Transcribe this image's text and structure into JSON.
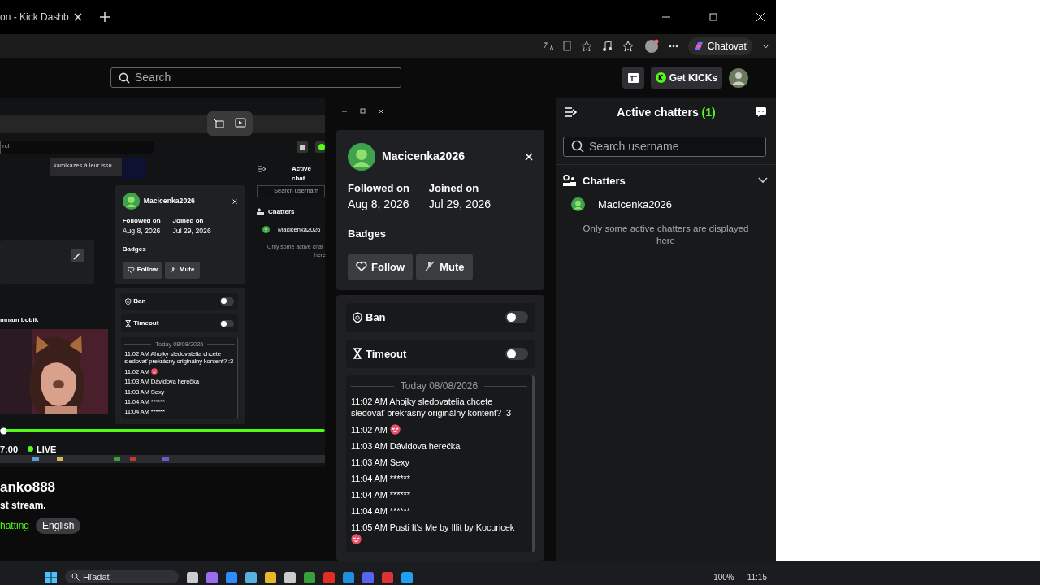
{
  "browser": {
    "tab_title": "on - Kick Dashb",
    "copilot_label": "Chatovať"
  },
  "header": {
    "search_placeholder": "Search",
    "kicks_button": "Get KICKs"
  },
  "preview": {
    "search_value": "rch",
    "tile_text": "kamikazes à leur issu",
    "caption": "mnam bobik",
    "time": "7:00",
    "live": "LIVE",
    "user_card": {
      "username": "Macicenka2026",
      "stats": [
        {
          "label": "Followed on",
          "value": "Aug 8, 2026"
        },
        {
          "label": "Joined on",
          "value": "Jul 29, 2026"
        }
      ],
      "badges_label": "Badges",
      "buttons": [
        {
          "kind": "follow",
          "label": "Follow"
        },
        {
          "kind": "mute",
          "label": "Mute"
        }
      ],
      "actions": [
        {
          "kind": "ban",
          "label": "Ban",
          "on": false
        },
        {
          "kind": "timeout",
          "label": "Timeout",
          "on": false
        }
      ],
      "chat_date": "Today 08/08/2026",
      "messages": [
        {
          "time": "11:02 AM",
          "text": "Ahojky sledovatelia chcete sledovať prekrásny originálny kontent? :3"
        },
        {
          "time": "11:02 AM",
          "emote": true
        },
        {
          "time": "11:03 AM",
          "text": "Dávidova herečka"
        },
        {
          "time": "11:03 AM",
          "text": "Sexy"
        },
        {
          "time": "11:04 AM",
          "text": "******"
        },
        {
          "time": "11:04 AM",
          "text": "******"
        }
      ]
    },
    "chatters": {
      "title": "Active chat",
      "search_placeholder": "Search usernam",
      "section": "Chatters",
      "user": "Macicenka2026",
      "note_lines": [
        "Only some active chat",
        "here"
      ]
    }
  },
  "stream": {
    "channel": "anko888",
    "description": "st stream.",
    "category": "hatting",
    "tags": [
      "English"
    ]
  },
  "user_card": {
    "username": "Macicenka2026",
    "stats": [
      {
        "label": "Followed on",
        "value": "Aug 8, 2026"
      },
      {
        "label": "Joined on",
        "value": "Jul 29, 2026"
      }
    ],
    "badges_label": "Badges",
    "buttons": [
      {
        "kind": "follow",
        "label": "Follow"
      },
      {
        "kind": "mute",
        "label": "Mute"
      }
    ],
    "actions": [
      {
        "kind": "ban",
        "label": "Ban",
        "on": false
      },
      {
        "kind": "timeout",
        "label": "Timeout",
        "on": false
      }
    ],
    "chat_date": "Today 08/08/2026",
    "messages": [
      {
        "time": "11:02 AM",
        "text": "Ahojky sledovatelia chcete sledovať prekrásny originálny kontent? :3"
      },
      {
        "time": "11:02 AM",
        "emote": true
      },
      {
        "time": "11:03 AM",
        "text": "Dávidova herečka"
      },
      {
        "time": "11:03 AM",
        "text": "Sexy"
      },
      {
        "time": "11:04 AM",
        "text": "******"
      },
      {
        "time": "11:04 AM",
        "text": "******"
      },
      {
        "time": "11:04 AM",
        "text": "******"
      },
      {
        "time": "11:05 AM",
        "text": "Pusti It's Me by Illit by Kocuricek",
        "emote": true
      }
    ]
  },
  "chatters_panel": {
    "title": "Active chatters",
    "count": "(1)",
    "search_placeholder": "Search username",
    "section": "Chatters",
    "expanded": true,
    "users": [
      {
        "name": "Macicenka2026"
      }
    ],
    "note": "Only some active chatters are displayed here"
  },
  "taskbar": {
    "search_placeholder": "Hľadať",
    "battery": "100%",
    "time": "11:15"
  }
}
